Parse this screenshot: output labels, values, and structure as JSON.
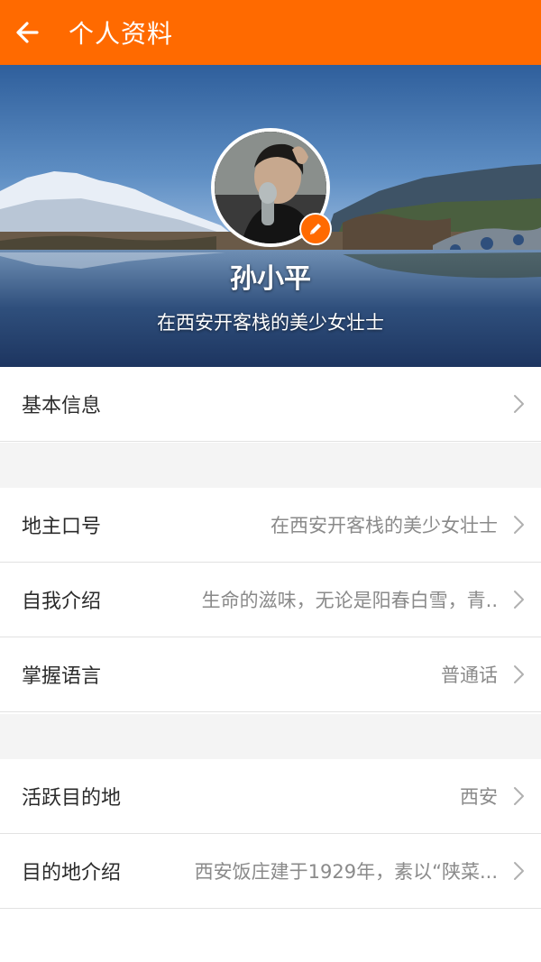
{
  "header": {
    "title": "个人资料",
    "back_icon": "back-arrow-icon",
    "color": "#ff6a00"
  },
  "profile": {
    "name": "孙小平",
    "slogan": "在西安开客栈的美少女壮士",
    "edit_icon": "pencil-icon"
  },
  "sections": {
    "basic": {
      "label": "基本信息"
    },
    "group2": [
      {
        "label": "地主口号",
        "value": "在西安开客栈的美少女壮士"
      },
      {
        "label": "自我介绍",
        "value": "生命的滋味，无论是阳春白雪，青.."
      },
      {
        "label": "掌握语言",
        "value": "普通话"
      }
    ],
    "group3": [
      {
        "label": "活跃目的地",
        "value": "西安"
      },
      {
        "label": "目的地介绍",
        "value": "西安饭庄建于1929年，素以“陕菜..."
      }
    ]
  },
  "chevron_icon": "chevron-right-icon"
}
